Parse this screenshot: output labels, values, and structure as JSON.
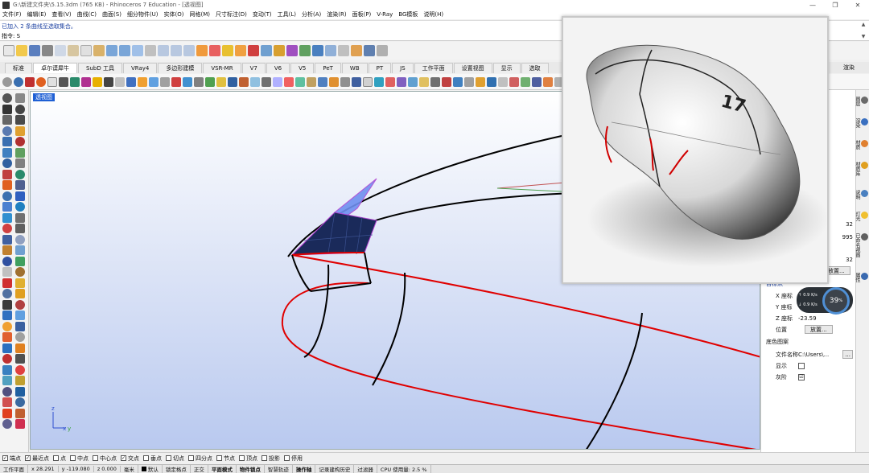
{
  "window": {
    "title": "G:\\新建文件夹\\5.15.3dm (765 KB) - Rhinoceros 7 Education - [透视图]",
    "controls": [
      "—",
      "❐",
      "✕"
    ]
  },
  "menu": [
    "文件(F)",
    "编辑(E)",
    "查看(V)",
    "曲线(C)",
    "曲面(S)",
    "细分物件(U)",
    "实体(O)",
    "网格(M)",
    "尺寸标注(D)",
    "变动(T)",
    "工具(L)",
    "分析(A)",
    "渲染(R)",
    "面板(P)",
    "V-Ray",
    "BG模板",
    "说明(H)"
  ],
  "command": {
    "history": "已加入 2 条曲线至选取集合。",
    "prompt": "指令: S"
  },
  "tabs": [
    "标准",
    "卓尔谟犀牛",
    "SubD 工具",
    "VRay4",
    "多边形建模",
    "VSR-MR",
    "V7",
    "V6",
    "V5",
    "PeT",
    "WB",
    "PT",
    "JS",
    "工作平面",
    "设置视图",
    "显示",
    "选取"
  ],
  "tabs_more": "渲染",
  "viewport": {
    "label": "透视图",
    "axis_x": "x",
    "axis_y": "y",
    "axis_z": "z"
  },
  "properties": {
    "partial_values": [
      "32",
      "995",
      "32"
    ],
    "partial_button": "放置...",
    "section_title": "目标点",
    "rows": [
      {
        "label": "X 座标",
        "value": ""
      },
      {
        "label": "Y 座标",
        "value": ""
      },
      {
        "label": "Z 座标",
        "value": "-23.59"
      },
      {
        "label": "位置",
        "value": "放置..."
      }
    ],
    "bg_section": "底色图案",
    "bg_rows": [
      {
        "label": "文件名称",
        "value": "C:\\Users\\..."
      },
      {
        "label": "显示",
        "value": ""
      },
      {
        "label": "灰阶",
        "value": "☑"
      }
    ]
  },
  "perf": {
    "percent": "39",
    "unit": "%",
    "line1": "0.9",
    "line1_unit": "K/s",
    "line2": "0.9",
    "line2_unit": "K/s"
  },
  "right_tabs": [
    "图层",
    "渲染",
    "材质",
    "材质库",
    "说明",
    "灯光",
    "已命名视图",
    "属性"
  ],
  "osnap": [
    {
      "label": "端点",
      "checked": true
    },
    {
      "label": "最近点",
      "checked": true
    },
    {
      "label": "点",
      "checked": false
    },
    {
      "label": "中点",
      "checked": false
    },
    {
      "label": "中心点",
      "checked": false
    },
    {
      "label": "交点",
      "checked": true
    },
    {
      "label": "垂点",
      "checked": false
    },
    {
      "label": "切点",
      "checked": false
    },
    {
      "label": "四分点",
      "checked": false
    },
    {
      "label": "节点",
      "checked": false
    },
    {
      "label": "顶点",
      "checked": false
    },
    {
      "label": "投影",
      "checked": false
    },
    {
      "label": "停用",
      "checked": false
    }
  ],
  "status": {
    "cplane": "工作平面",
    "x": "x 28.291",
    "y": "y -119.080",
    "z": "z 0.000",
    "units": "毫米",
    "layer": "默认",
    "items": [
      "锁定格点",
      "正交",
      "平面模式",
      "物件锁点",
      "智慧轨迹",
      "操作轴",
      "记录建构历史",
      "过滤器",
      "CPU 使用量: 2.5 %"
    ]
  },
  "preview": {
    "number_text": "17"
  },
  "colors": {
    "viewport_top": "#ffffff",
    "viewport_bottom": "#b9c9ef",
    "red_curve": "#e00000",
    "select_blue": "#1e5fd4"
  }
}
